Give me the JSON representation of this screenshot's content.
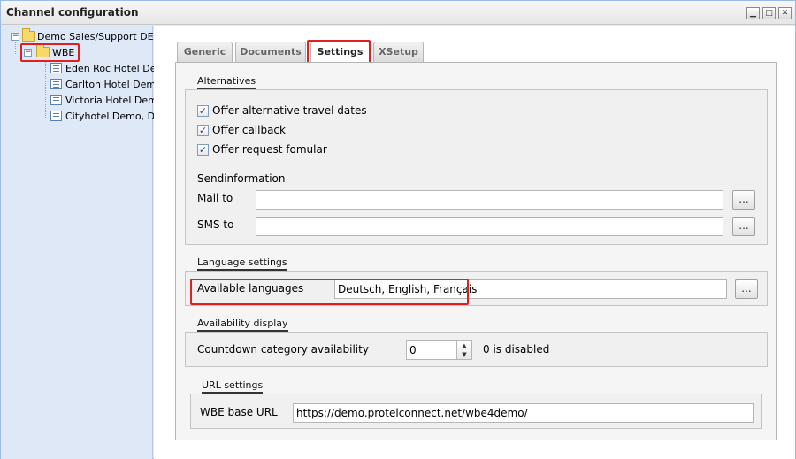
{
  "window": {
    "title": "Channel configuration"
  },
  "window_buttons": {
    "minimize": "▁",
    "maximize": "□",
    "close": "✕"
  },
  "tree": {
    "root": {
      "label": "Demo Sales/Support DE",
      "expander": "−"
    },
    "wbe": {
      "label": "WBE",
      "expander": "−"
    },
    "hotels": [
      {
        "label": "Eden Roc Hotel De."
      },
      {
        "label": "Carlton Hotel Dem."
      },
      {
        "label": "Victoria Hotel Dem."
      },
      {
        "label": "Cityhotel Demo, D-"
      }
    ]
  },
  "tabs": [
    {
      "label": "Generic"
    },
    {
      "label": "Documents"
    },
    {
      "label": "Settings"
    },
    {
      "label": "XSetup"
    }
  ],
  "alternatives": {
    "legend": "Alternatives",
    "checks": [
      {
        "label": "Offer alternative travel dates",
        "mark": "✓"
      },
      {
        "label": "Offer callback",
        "mark": "✓"
      },
      {
        "label": "Offer request fomular",
        "mark": "✓"
      }
    ],
    "sendinfo_label": "Sendinformation",
    "mail_label": "Mail to",
    "mail_value": "",
    "sms_label": "SMS to",
    "sms_value": "",
    "dots": "..."
  },
  "language": {
    "legend": "Language settings",
    "available_label": "Available languages",
    "available_value": "Deutsch, English, Français",
    "dots": "..."
  },
  "availability": {
    "legend": "Availability display",
    "countdown_label": "Countdown category availability",
    "countdown_value": "0",
    "hint": "0 is disabled",
    "spin_up": "▲",
    "spin_down": "▼"
  },
  "url": {
    "legend": "URL settings",
    "base_label": "WBE base URL",
    "base_value": "https://demo.protelconnect.net/wbe4demo/"
  }
}
